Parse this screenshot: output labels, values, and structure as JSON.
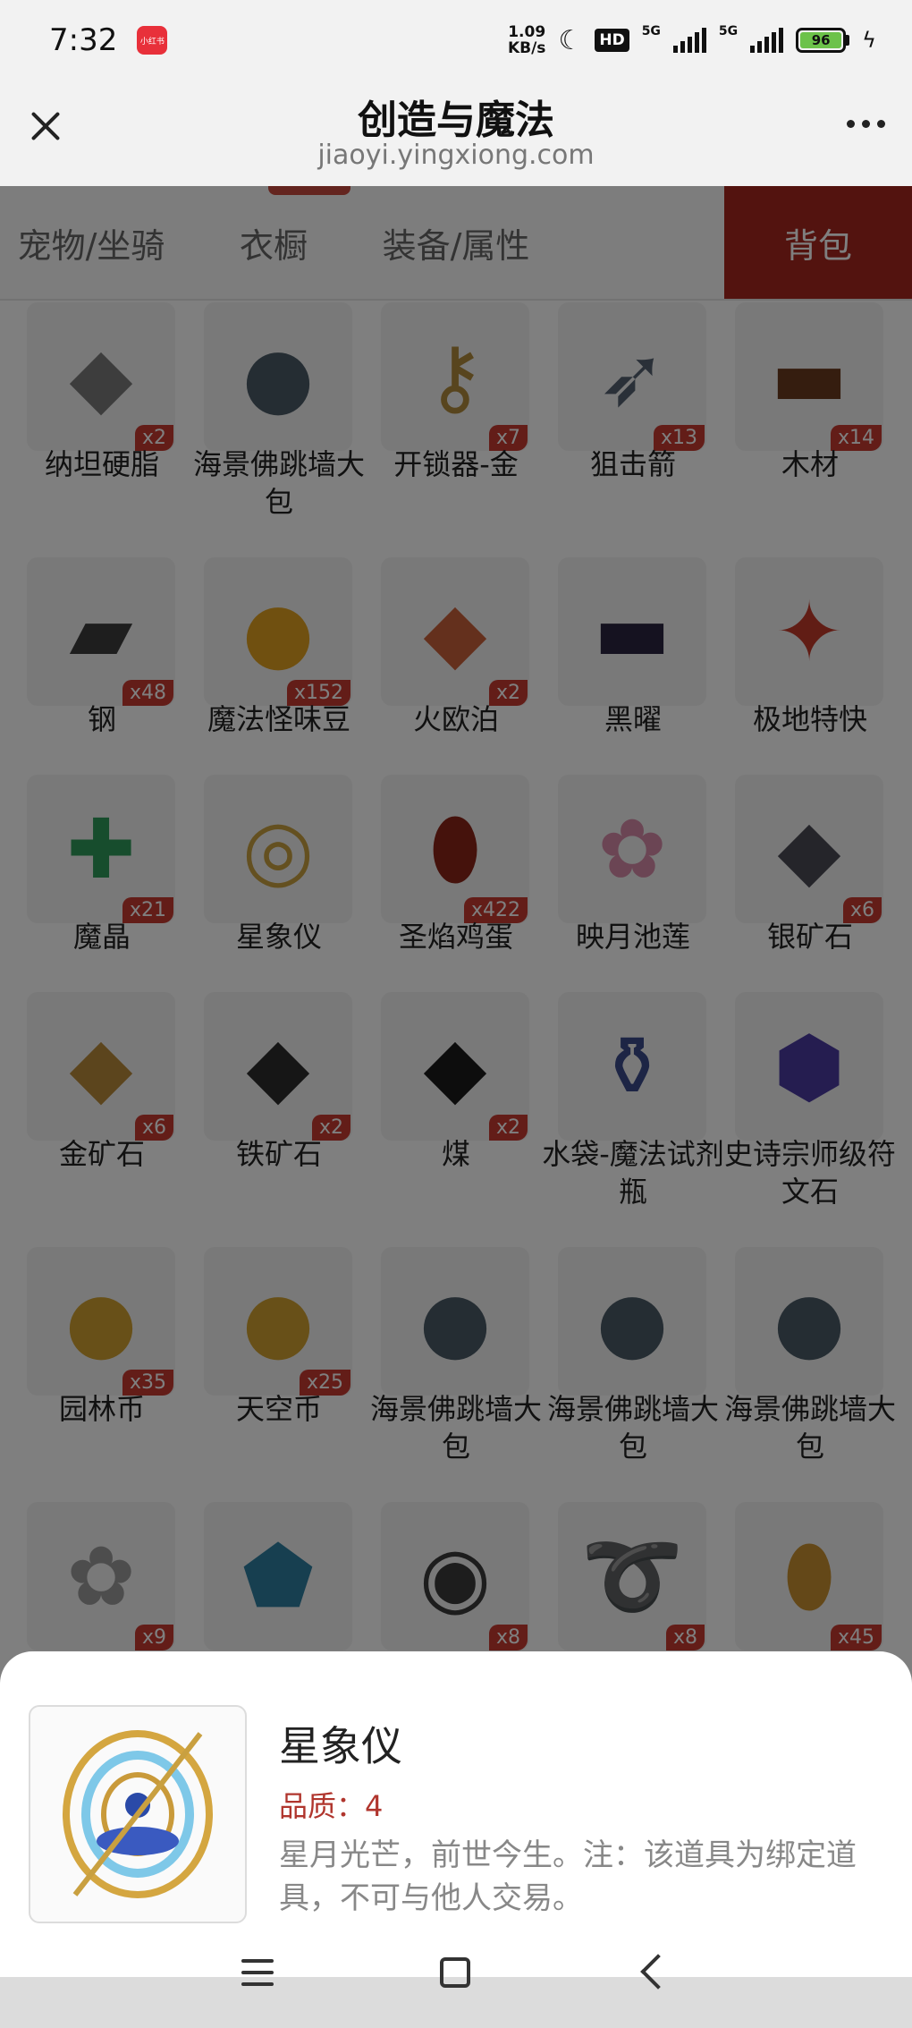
{
  "status_bar": {
    "time": "7:32",
    "app_badge": "小红书",
    "speed_value": "1.09",
    "speed_unit": "KB/s",
    "hd": "HD",
    "net1": "5G",
    "net2": "5G",
    "battery": "96"
  },
  "header": {
    "title": "创造与魔法",
    "url": "jiaoyi.yingxiong.com"
  },
  "tabs": [
    {
      "label": "宠物/坐骑"
    },
    {
      "label": "衣橱"
    },
    {
      "label": "装备/属性"
    },
    {
      "label": "背包",
      "active": true
    }
  ],
  "items": [
    {
      "name": "纳坦硬脂",
      "qty": "x2",
      "icon": "grey-stone-icon",
      "glyph": "◆",
      "color": "#7b7b7b"
    },
    {
      "name": "海景佛跳墙大包",
      "qty": "",
      "icon": "dumpling-plate-icon",
      "glyph": "●",
      "color": "#4a5a66"
    },
    {
      "name": "开锁器-金",
      "qty": "x7",
      "icon": "gold-keys-icon",
      "glyph": "⚷",
      "color": "#b08a3c"
    },
    {
      "name": "狙击箭",
      "qty": "x13",
      "icon": "arrows-icon",
      "glyph": "➶",
      "color": "#556070"
    },
    {
      "name": "木材",
      "qty": "x14",
      "icon": "wood-log-icon",
      "glyph": "▬",
      "color": "#6b3b1e"
    },
    {
      "name": "钢",
      "qty": "x48",
      "icon": "steel-ingot-icon",
      "glyph": "▰",
      "color": "#3c3c3c"
    },
    {
      "name": "魔法怪味豆",
      "qty": "x152",
      "icon": "magic-bean-icon",
      "glyph": "●",
      "color": "#e0a020"
    },
    {
      "name": "火欧泊",
      "qty": "x2",
      "icon": "fire-opal-icon",
      "glyph": "◆",
      "color": "#c9603a"
    },
    {
      "name": "黑曜",
      "qty": "",
      "icon": "black-car-icon",
      "glyph": "▬",
      "color": "#2a2540"
    },
    {
      "name": "极地特快",
      "qty": "",
      "icon": "sleigh-icon",
      "glyph": "✦",
      "color": "#c23a2a"
    },
    {
      "name": "魔晶",
      "qty": "x21",
      "icon": "magic-crystal-icon",
      "glyph": "✚",
      "color": "#2f9a5a"
    },
    {
      "name": "星象仪",
      "qty": "",
      "icon": "astrolabe-icon",
      "glyph": "◎",
      "color": "#c9a040"
    },
    {
      "name": "圣焰鸡蛋",
      "qty": "x422",
      "icon": "egg-icon",
      "glyph": "⬮",
      "color": "#8a2418"
    },
    {
      "name": "映月池莲",
      "qty": "",
      "icon": "lotus-icon",
      "glyph": "✿",
      "color": "#d68aa8"
    },
    {
      "name": "银矿石",
      "qty": "x6",
      "icon": "silver-ore-icon",
      "glyph": "◆",
      "color": "#4a4a55"
    },
    {
      "name": "金矿石",
      "qty": "x6",
      "icon": "gold-ore-icon",
      "glyph": "◆",
      "color": "#b88a3a"
    },
    {
      "name": "铁矿石",
      "qty": "x2",
      "icon": "iron-ore-icon",
      "glyph": "◆",
      "color": "#2c2c2c"
    },
    {
      "name": "煤",
      "qty": "x2",
      "icon": "coal-icon",
      "glyph": "◆",
      "color": "#1a1a1a"
    },
    {
      "name": "水袋-魔法试剂瓶",
      "qty": "",
      "icon": "potion-bottle-icon",
      "glyph": "⚱",
      "color": "#3a4a8a"
    },
    {
      "name": "史诗宗师级符文石",
      "qty": "",
      "icon": "rune-stone-icon",
      "glyph": "⬢",
      "color": "#4a3aa0"
    },
    {
      "name": "园林币",
      "qty": "x35",
      "icon": "garden-coin-icon",
      "glyph": "●",
      "color": "#d0a030"
    },
    {
      "name": "天空币",
      "qty": "x25",
      "icon": "sky-coin-icon",
      "glyph": "●",
      "color": "#d0a030"
    },
    {
      "name": "海景佛跳墙大包",
      "qty": "",
      "icon": "dumpling-plate-icon",
      "glyph": "●",
      "color": "#4a5a66"
    },
    {
      "name": "海景佛跳墙大包",
      "qty": "",
      "icon": "dumpling-plate-icon",
      "glyph": "●",
      "color": "#4a5a66"
    },
    {
      "name": "海景佛跳墙大包",
      "qty": "",
      "icon": "dumpling-plate-icon",
      "glyph": "●",
      "color": "#4a5a66"
    },
    {
      "name": "",
      "qty": "x9",
      "icon": "silver-flower-icon",
      "glyph": "✿",
      "color": "#9a9a9a"
    },
    {
      "name": "",
      "qty": "",
      "icon": "blue-gem-icon",
      "glyph": "⬟",
      "color": "#2f7fa0"
    },
    {
      "name": "",
      "qty": "x8",
      "icon": "rune-coin-icon",
      "glyph": "◉",
      "color": "#3a3a3a"
    },
    {
      "name": "",
      "qty": "x8",
      "icon": "rope-icon",
      "glyph": "➰",
      "color": "#b08a40"
    },
    {
      "name": "",
      "qty": "x45",
      "icon": "lucky-bag-icon",
      "glyph": "⬮",
      "color": "#c89030"
    }
  ],
  "sheet": {
    "name": "星象仪",
    "quality": "品质：4",
    "description": "星月光芒，前世今生。注：该道具为绑定道具，不可与他人交易。",
    "icon": "astrolabe-icon"
  },
  "colors": {
    "accent": "#a7261f",
    "quantity_badge": "#c63a31",
    "quality_text": "#b0352d"
  }
}
